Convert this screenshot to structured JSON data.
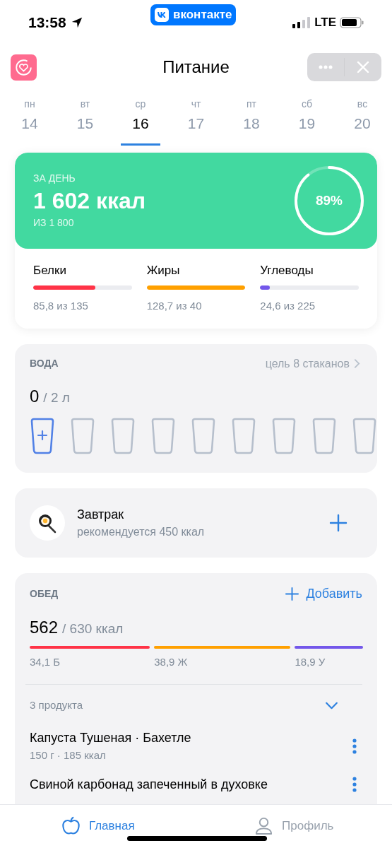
{
  "status_bar": {
    "time": "13:58",
    "app_badge": "вконтакте",
    "network": "LTE"
  },
  "header": {
    "title": "Питание"
  },
  "days": [
    {
      "weekday": "пн",
      "date": "14",
      "selected": false
    },
    {
      "weekday": "вт",
      "date": "15",
      "selected": false
    },
    {
      "weekday": "ср",
      "date": "16",
      "selected": true
    },
    {
      "weekday": "чт",
      "date": "17",
      "selected": false
    },
    {
      "weekday": "пт",
      "date": "18",
      "selected": false
    },
    {
      "weekday": "сб",
      "date": "19",
      "selected": false
    },
    {
      "weekday": "вс",
      "date": "20",
      "selected": false
    }
  ],
  "summary": {
    "label": "ЗА ДЕНЬ",
    "calories": "1 602 ккал",
    "target": "ИЗ 1 800",
    "percent": "89%",
    "level": 0.89,
    "macros": [
      {
        "name": "Белки",
        "level": 0.63,
        "reading": "85,8 из 135",
        "color": "#ff3347"
      },
      {
        "name": "Жиры",
        "level": 1,
        "reading": "128,7 из 40",
        "color": "#ffa000"
      },
      {
        "name": "Углеводы",
        "level": 0.1,
        "reading": "24,6 из 225",
        "color": "#7357ea"
      }
    ]
  },
  "water": {
    "title": "ВОДА",
    "goal": "цель 8 стаканов",
    "amount": "0",
    "total": "/ 2 л",
    "glasses": [
      {
        "kind": "add"
      },
      {
        "kind": "empty"
      },
      {
        "kind": "empty"
      },
      {
        "kind": "empty"
      },
      {
        "kind": "empty"
      },
      {
        "kind": "empty"
      },
      {
        "kind": "empty"
      },
      {
        "kind": "empty"
      },
      {
        "kind": "empty"
      }
    ]
  },
  "breakfast": {
    "name": "Завтрак",
    "subtitle": "рекомендуется 450 ккал"
  },
  "lunch": {
    "title": "ОБЕД",
    "add_label": "Добавить",
    "eaten": "562",
    "total": "/ 630 ккал",
    "macros": [
      {
        "reading": "34,1 Б",
        "color": "#ff3347"
      },
      {
        "reading": "38,9 Ж",
        "color": "#ffa000"
      },
      {
        "reading": "18,9 У",
        "color": "#7357ea"
      }
    ],
    "products_count": "3 продукта",
    "expanded": true,
    "products": [
      {
        "name": "Капуста Тушеная · Бахетле",
        "details": "150 г · 185 ккал"
      },
      {
        "name": "Свиной карбонад запеченный в духовке"
      }
    ]
  },
  "tabs": [
    {
      "label": "Главная",
      "selected": true
    },
    {
      "label": "Профиль",
      "selected": false
    }
  ]
}
